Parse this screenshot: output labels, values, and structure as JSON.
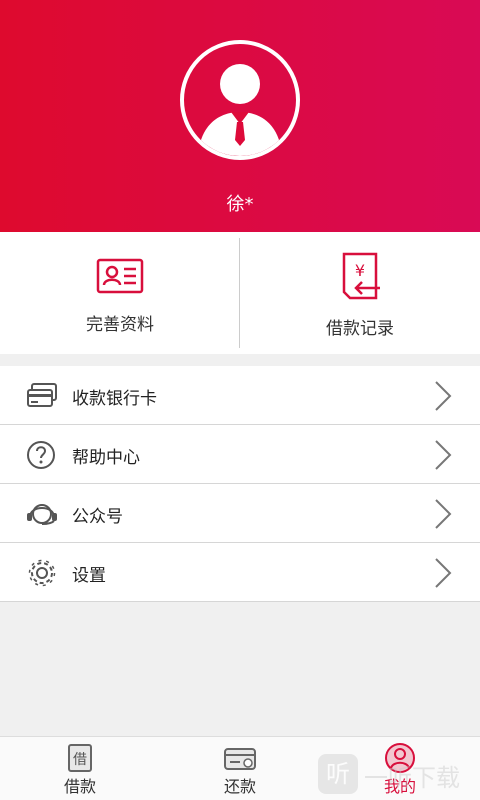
{
  "profile": {
    "username": "徐*"
  },
  "quick_actions": [
    {
      "label": "完善资料",
      "icon": "profile-card-icon"
    },
    {
      "label": "借款记录",
      "icon": "loan-record-icon"
    }
  ],
  "menu": [
    {
      "label": "收款银行卡",
      "icon": "bank-card-icon"
    },
    {
      "label": "帮助中心",
      "icon": "help-icon"
    },
    {
      "label": "公众号",
      "icon": "headset-icon"
    },
    {
      "label": "设置",
      "icon": "settings-gear-icon"
    }
  ],
  "tabbar": [
    {
      "label": "借款",
      "icon": "borrow-icon",
      "active": false
    },
    {
      "label": "还款",
      "icon": "repay-card-icon",
      "active": false
    },
    {
      "label": "我的",
      "icon": "user-icon",
      "active": true
    }
  ],
  "watermark": {
    "text": "一听下载",
    "mark": "听"
  },
  "colors": {
    "header_start": "#de0a2e",
    "header_end": "#d90a55",
    "accent": "#d80f3c"
  }
}
